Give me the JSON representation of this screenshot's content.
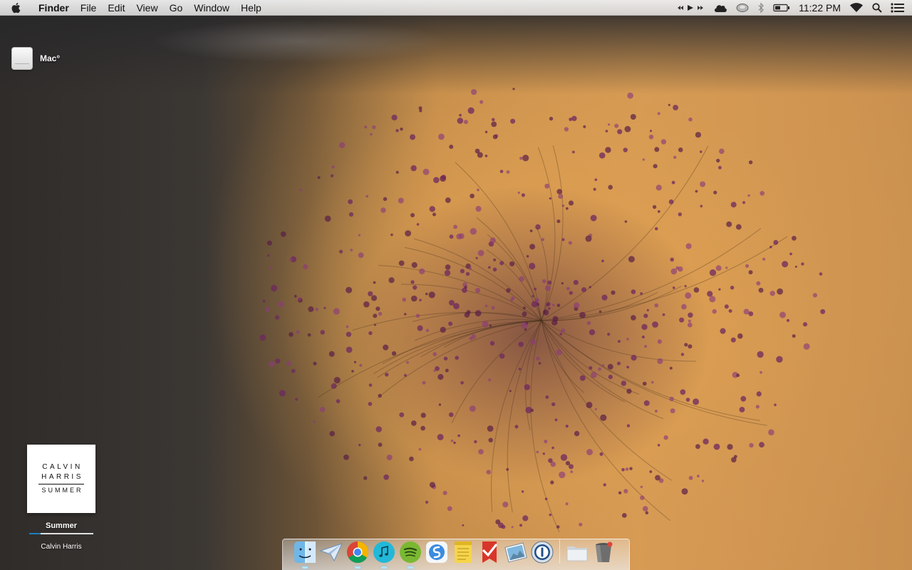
{
  "menubar": {
    "app_name": "Finder",
    "menus": [
      "File",
      "Edit",
      "View",
      "Go",
      "Window",
      "Help"
    ],
    "clock": "11:22 PM",
    "status_icons": [
      "media-controls-icon",
      "cloud-icon",
      "disk-icon",
      "bluetooth-icon",
      "battery-icon",
      "wifi-icon",
      "spotlight-icon",
      "notification-center-icon"
    ]
  },
  "desktop": {
    "drive_label": "Mac°"
  },
  "now_playing": {
    "album_line1": "CALVIN",
    "album_line2": "HARRIS",
    "album_line3": "SUMMER",
    "title": "Summer",
    "artist": "Calvin Harris",
    "progress": 0.18
  },
  "dock": {
    "items": [
      "finder-icon",
      "airmail-icon",
      "chrome-icon",
      "music-icon",
      "spotify-icon",
      "simplenote-icon",
      "notes-icon",
      "wunderlist-icon",
      "preview-icon",
      "onepassword-icon",
      "folder-icon",
      "trash-icon"
    ],
    "running": [
      "finder-icon",
      "chrome-icon",
      "music-icon",
      "spotify-icon"
    ]
  },
  "colors": {
    "accent": "#1e7fc0",
    "wallpaper_warm": "#d89b55",
    "wallpaper_dark": "#2f2c2a"
  }
}
